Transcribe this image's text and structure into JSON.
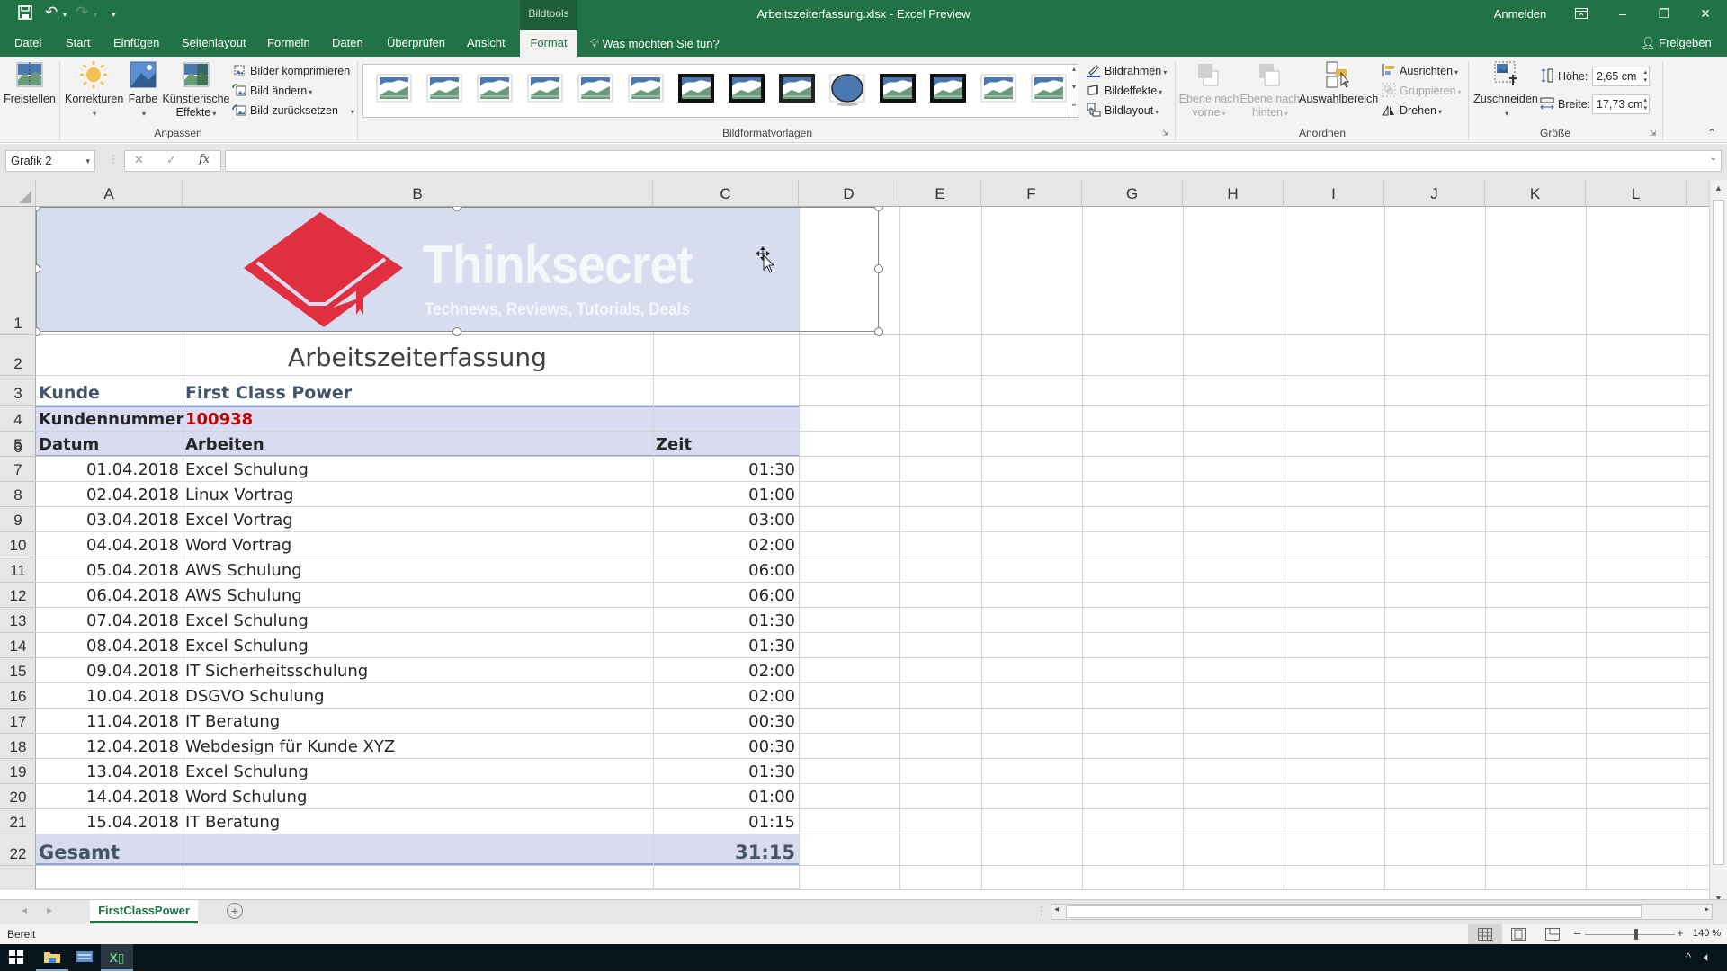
{
  "window": {
    "context_tab_group": "Bildtools",
    "title": "Arbeitszeiterfassung.xlsx  -  Excel Preview",
    "sign_in": "Anmelden",
    "minimize": "–",
    "restore": "❐",
    "close": "✕",
    "ribbon_display": "⊡"
  },
  "qat": {
    "save": "💾",
    "undo": "↶",
    "redo": "↷",
    "customize": "▾"
  },
  "tabs": [
    {
      "label": "Datei"
    },
    {
      "label": "Start"
    },
    {
      "label": "Einfügen"
    },
    {
      "label": "Seitenlayout"
    },
    {
      "label": "Formeln"
    },
    {
      "label": "Daten"
    },
    {
      "label": "Überprüfen"
    },
    {
      "label": "Ansicht"
    },
    {
      "label": "Format",
      "active": true
    }
  ],
  "tell_me": "Was möchten Sie tun?",
  "share": "Freigeben",
  "ribbon": {
    "anpassen": {
      "label": "Anpassen",
      "freistellen": "Freistellen",
      "korrekturen": "Korrekturen",
      "farbe": "Farbe",
      "kuenstlerische_1": "Künstlerische",
      "kuenstlerische_2": "Effekte",
      "komprimieren": "Bilder komprimieren",
      "aendern": "Bild ändern",
      "zuruecksetzen": "Bild zurücksetzen"
    },
    "bildformatvorlagen": {
      "label": "Bildformatvorlagen",
      "styles_count": 14,
      "bildrahmen": "Bildrahmen",
      "bildeffekte": "Bildeffekte",
      "bildlayout": "Bildlayout"
    },
    "anordnen": {
      "label": "Anordnen",
      "vorne_1": "Ebene nach",
      "vorne_2": "vorne",
      "hinten_1": "Ebene nach",
      "hinten_2": "hinten",
      "auswahlbereich": "Auswahlbereich",
      "ausrichten": "Ausrichten",
      "gruppieren": "Gruppieren",
      "drehen": "Drehen"
    },
    "groesse": {
      "label": "Größe",
      "zuschneiden": "Zuschneiden",
      "hoehe_label": "Höhe:",
      "hoehe_value": "2,65 cm",
      "breite_label": "Breite:",
      "breite_value": "17,73 cm"
    }
  },
  "formula_bar": {
    "name_box": "Grafik 2",
    "cancel": "✕",
    "enter": "✓",
    "fx": "fx",
    "formula": ""
  },
  "columns": [
    "A",
    "B",
    "C",
    "D",
    "E",
    "F",
    "G",
    "H",
    "I",
    "J",
    "K",
    "L"
  ],
  "rows": [
    "1",
    "2",
    "3",
    "4",
    "5",
    "6",
    "7",
    "8",
    "9",
    "10",
    "11",
    "12",
    "13",
    "14",
    "15",
    "16",
    "17",
    "18",
    "19",
    "20",
    "21",
    "22"
  ],
  "logo": {
    "brand": "Thinksecret",
    "tagline": "Technews, Reviews, Tutorials, Deals",
    "brand_color": "#e0303f"
  },
  "sheet": {
    "title": "Arbeitszeiterfassung",
    "kunde_label": "Kunde",
    "kunde_value": "First Class Power",
    "kundennummer_label": "Kundennummer",
    "kundennummer_value": "100938",
    "kundennummer_color": "#c00000",
    "headers": {
      "datum": "Datum",
      "arbeiten": "Arbeiten",
      "zeit": "Zeit"
    },
    "entries": [
      {
        "datum": "01.04.2018",
        "arbeiten": "Excel Schulung",
        "zeit": "01:30"
      },
      {
        "datum": "02.04.2018",
        "arbeiten": "Linux Vortrag",
        "zeit": "01:00"
      },
      {
        "datum": "03.04.2018",
        "arbeiten": "Excel Vortrag",
        "zeit": "03:00"
      },
      {
        "datum": "04.04.2018",
        "arbeiten": "Word Vortrag",
        "zeit": "02:00"
      },
      {
        "datum": "05.04.2018",
        "arbeiten": "AWS Schulung",
        "zeit": "06:00"
      },
      {
        "datum": "06.04.2018",
        "arbeiten": "AWS Schulung",
        "zeit": "06:00"
      },
      {
        "datum": "07.04.2018",
        "arbeiten": "Excel Schulung",
        "zeit": "01:30"
      },
      {
        "datum": "08.04.2018",
        "arbeiten": "Excel Schulung",
        "zeit": "01:30"
      },
      {
        "datum": "09.04.2018",
        "arbeiten": "IT Sicherheitsschulung",
        "zeit": "02:00"
      },
      {
        "datum": "10.04.2018",
        "arbeiten": "DSGVO Schulung",
        "zeit": "02:00"
      },
      {
        "datum": "11.04.2018",
        "arbeiten": "IT Beratung",
        "zeit": "00:30"
      },
      {
        "datum": "12.04.2018",
        "arbeiten": "Webdesign für Kunde XYZ",
        "zeit": "00:30"
      },
      {
        "datum": "13.04.2018",
        "arbeiten": "Excel Schulung",
        "zeit": "01:30"
      },
      {
        "datum": "14.04.2018",
        "arbeiten": "Word Schulung",
        "zeit": "01:00"
      },
      {
        "datum": "15.04.2018",
        "arbeiten": "IT Beratung",
        "zeit": "01:15"
      }
    ],
    "gesamt_label": "Gesamt",
    "gesamt_value": "31:15",
    "accent_color": "#44546a",
    "band_color": "#d9dcf0"
  },
  "sheet_tabs": [
    {
      "label": "FirstClassPower",
      "active": true
    }
  ],
  "add_sheet": "+",
  "status": {
    "ready": "Bereit",
    "zoom_level": "140 %",
    "zoom_minus": "–",
    "zoom_plus": "+"
  }
}
